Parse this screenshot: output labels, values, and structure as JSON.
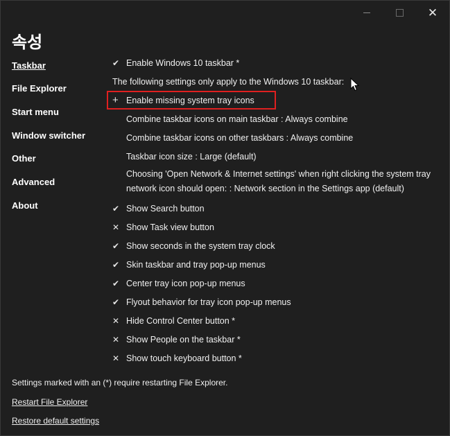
{
  "window": {
    "title": "속성",
    "controls": {
      "minimize_icon": "minimize-icon",
      "maximize_icon": "maximize-icon",
      "close_icon": "close-icon",
      "close_glyph": "✕"
    }
  },
  "sidebar": {
    "items": [
      {
        "label": "Taskbar",
        "active": true
      },
      {
        "label": "File Explorer",
        "active": false
      },
      {
        "label": "Start menu",
        "active": false
      },
      {
        "label": "Window switcher",
        "active": false
      },
      {
        "label": "Other",
        "active": false
      },
      {
        "label": "Advanced",
        "active": false
      },
      {
        "label": "About",
        "active": false
      }
    ]
  },
  "settings": {
    "enable_win10_taskbar": {
      "mark": "✔",
      "label": "Enable Windows 10 taskbar *"
    },
    "info": "The following settings only apply to the Windows 10 taskbar:",
    "enable_missing_tray": {
      "mark": "+",
      "label": "Enable missing system tray icons"
    },
    "combine_main": {
      "label": "Combine taskbar icons on main taskbar : Always combine"
    },
    "combine_other": {
      "label": "Combine taskbar icons on other taskbars : Always combine"
    },
    "icon_size": {
      "label": "Taskbar icon size : Large (default)"
    },
    "network_open": {
      "label": "Choosing 'Open Network & Internet settings' when right clicking the system tray network icon should open: : Network section in the Settings app (default)"
    },
    "show_search": {
      "mark": "✔",
      "label": "Show Search button"
    },
    "show_task_view": {
      "mark": "✕",
      "label": "Show Task view button"
    },
    "show_seconds": {
      "mark": "✔",
      "label": "Show seconds in the system tray clock"
    },
    "skin_menus": {
      "mark": "✔",
      "label": "Skin taskbar and tray pop-up menus"
    },
    "center_popups": {
      "mark": "✔",
      "label": "Center tray icon pop-up menus"
    },
    "flyout_behavior": {
      "mark": "✔",
      "label": "Flyout behavior for tray icon pop-up menus"
    },
    "hide_control_center": {
      "mark": "✕",
      "label": "Hide Control Center button *"
    },
    "show_people": {
      "mark": "✕",
      "label": "Show People on the taskbar *"
    },
    "show_touch_keyboard": {
      "mark": "✕",
      "label": "Show touch keyboard button *"
    }
  },
  "footer": {
    "note": "Settings marked with an (*) require restarting File Explorer.",
    "restart_link": "Restart File Explorer",
    "restore_link": "Restore default settings"
  },
  "colors": {
    "background": "#1f1f1f",
    "text": "#f0f0f0",
    "highlight": "#e02020"
  },
  "icons": {
    "check": "check-icon",
    "cross": "cross-icon",
    "plus": "plus-icon",
    "cursor": "mouse-pointer-icon"
  }
}
